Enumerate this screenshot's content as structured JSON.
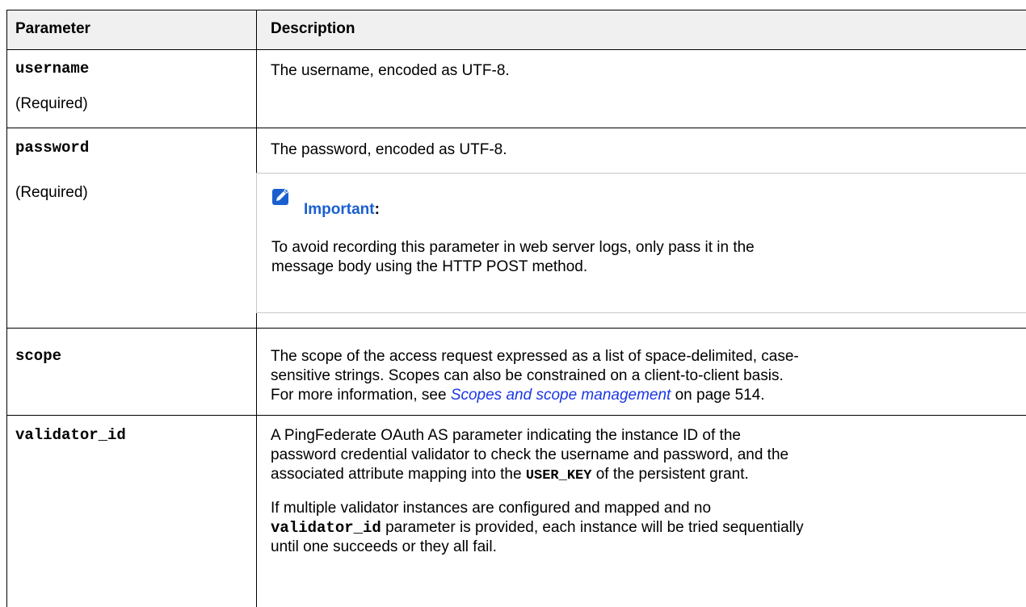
{
  "header": {
    "col_parameter": "Parameter",
    "col_description": "Description"
  },
  "rows": {
    "username": {
      "name": "username",
      "required": "(Required)",
      "description": "The username, encoded as UTF-8."
    },
    "password": {
      "name": "password",
      "required": "(Required)",
      "description": "The password, encoded as UTF-8.",
      "note": {
        "icon": "pencil-note-icon",
        "title": "Important",
        "title_suffix": ":",
        "body_line1": "To avoid recording this parameter in web server logs, only pass it in the",
        "body_line2": "message body using the HTTP POST method."
      }
    },
    "scope": {
      "name": "scope",
      "desc_line1": "The scope of the access request expressed as a list of space-delimited, case-",
      "desc_line2": "sensitive strings. Scopes can also be constrained on a client-to-client basis.",
      "desc_line3_prefix": "For more information, see ",
      "link_text": "Scopes and scope management",
      "desc_line3_suffix": " on page 514."
    },
    "validator_id": {
      "name": "validator_id",
      "p1_line1": "A PingFederate OAuth AS parameter indicating the instance ID of the",
      "p1_line2": "password credential validator to check the username and password, and the",
      "p1_line3_prefix": "associated attribute mapping into the ",
      "user_key": "USER_KEY",
      "p1_line3_suffix": " of the persistent grant.",
      "p2_line1": "If multiple validator instances are configured and mapped and no",
      "p2_code": "validator_id",
      "p2_line2_suffix": " parameter is provided, each instance will be tried sequentially",
      "p2_line3": "until one succeeds or they all fail."
    }
  },
  "colors": {
    "header_bg": "#f0f0f0",
    "link": "#1a37e6",
    "note_title": "#1a5fd0",
    "note_icon": "#1a5fd0"
  }
}
